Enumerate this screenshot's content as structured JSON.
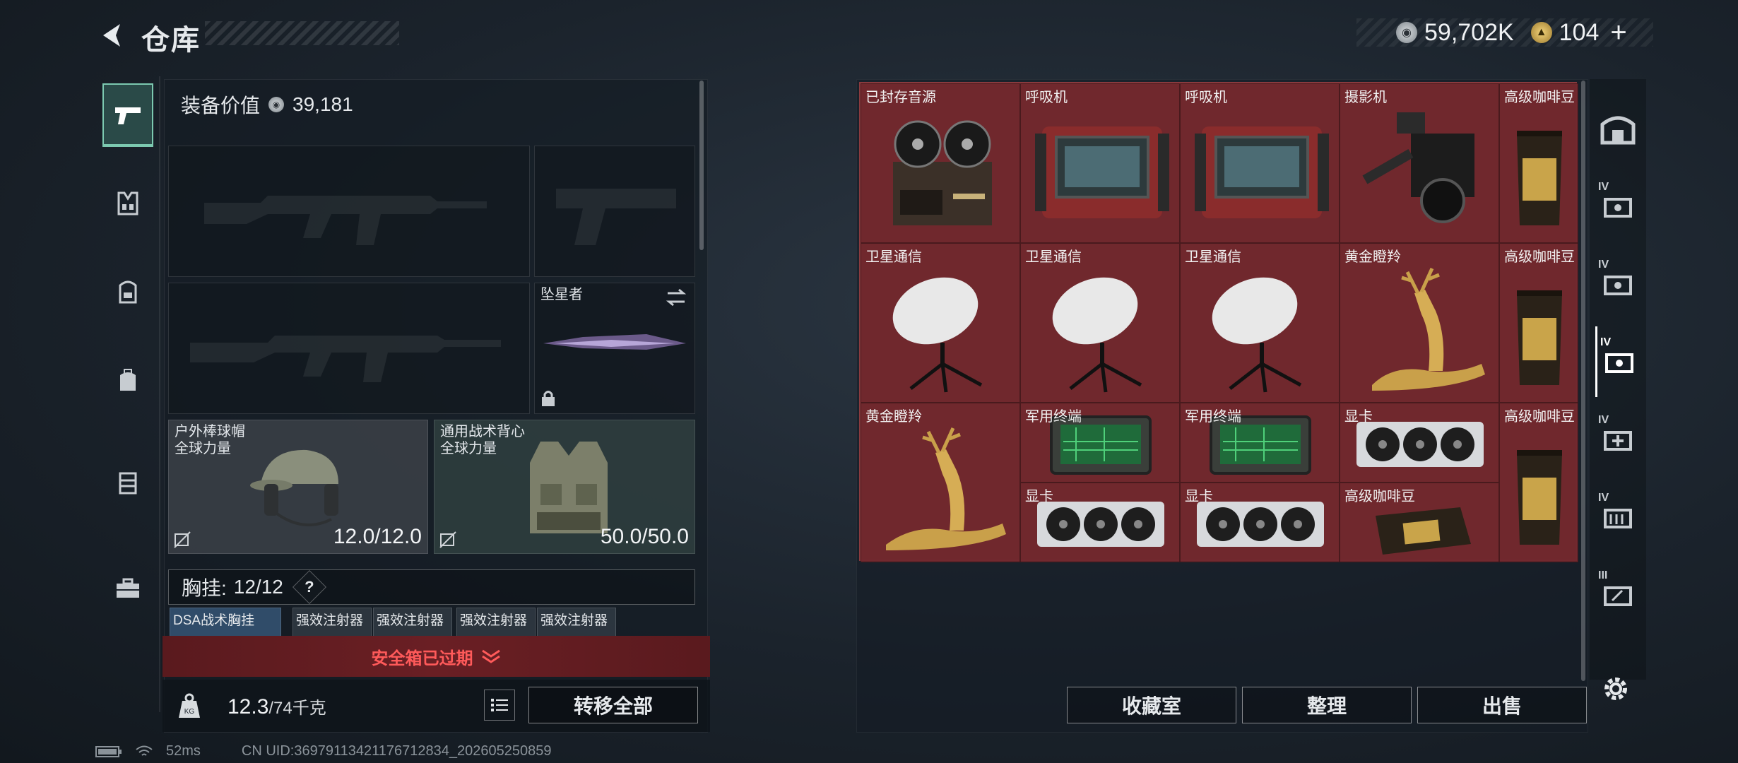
{
  "header": {
    "title": "仓库",
    "currency_silver": "59,702K",
    "currency_gold": "104",
    "plus": "+"
  },
  "left": {
    "equipment_value_label": "装备价值",
    "equipment_value": "39,181",
    "melee_name": "坠星者",
    "helmet_name": "户外棒球帽",
    "helmet_sub": "全球力量",
    "helmet_durability": "12.0/12.0",
    "armor_name": "通用战术背心",
    "armor_sub": "全球力量",
    "armor_durability": "50.0/50.0",
    "chest_rig_label": "胸挂:",
    "chest_rig_count": "12/12",
    "help": "?",
    "mini_items": [
      "DSA战术胸挂",
      "强效注射器",
      "强效注射器",
      "强效注射器",
      "强效注射器"
    ],
    "safe_box_expired": "安全箱已过期",
    "weight_value": "12.3",
    "weight_max": "/74千克",
    "move_all": "转移全部"
  },
  "grid": {
    "items": [
      {
        "label": "已封存音源",
        "icon": "reel-recorder-icon"
      },
      {
        "label": "呼吸机",
        "icon": "ventilator-icon"
      },
      {
        "label": "呼吸机",
        "icon": "ventilator-icon"
      },
      {
        "label": "摄影机",
        "icon": "camera-icon"
      },
      {
        "label": "高级咖啡豆",
        "icon": "coffee-bag-icon"
      },
      {
        "label": "卫星通信",
        "icon": "satellite-dish-icon"
      },
      {
        "label": "卫星通信",
        "icon": "satellite-dish-icon"
      },
      {
        "label": "卫星通信",
        "icon": "satellite-dish-icon"
      },
      {
        "label": "黄金瞪羚",
        "icon": "golden-gazelle-icon"
      },
      {
        "label": "高级咖啡豆",
        "icon": "coffee-bag-icon"
      },
      {
        "label": "黄金瞪羚",
        "icon": "golden-gazelle-icon"
      },
      {
        "label": "军用终端",
        "icon": "military-terminal-icon"
      },
      {
        "label": "军用终端",
        "icon": "military-terminal-icon"
      },
      {
        "label": "显卡",
        "icon": "graphics-card-icon"
      },
      {
        "label": "高级咖啡豆",
        "icon": "coffee-bag-icon"
      },
      {
        "label": "显卡",
        "icon": "graphics-card-icon"
      },
      {
        "label": "显卡",
        "icon": "graphics-card-icon"
      },
      {
        "label": "高级咖啡豆",
        "icon": "coffee-bag-icon"
      }
    ]
  },
  "actions": {
    "collection": "收藏室",
    "organize": "整理",
    "sell": "出售"
  },
  "status": {
    "ping": "52ms",
    "uid": "CN UID:3697911342117671283‌4_202605250859"
  },
  "rail_tiers": [
    "IV",
    "IV",
    "IV",
    "IV",
    "IV",
    "III"
  ]
}
